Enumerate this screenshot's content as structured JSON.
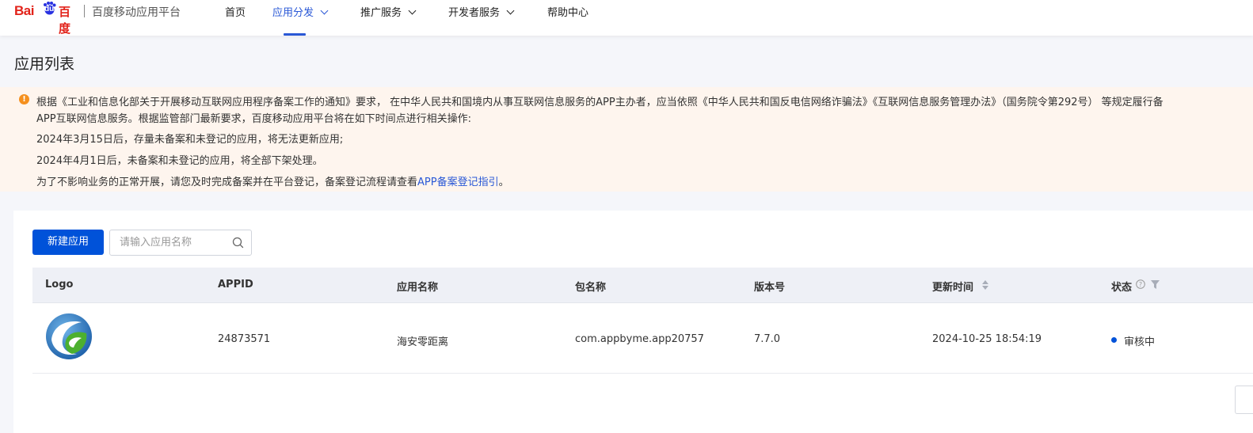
{
  "header": {
    "logo_latin": "Bai",
    "logo_du": "du",
    "logo_cn": "百度",
    "platform_name": "百度移动应用平台",
    "nav": [
      {
        "label": "首页",
        "active": false,
        "dropdown": false
      },
      {
        "label": "应用分发",
        "active": true,
        "dropdown": true
      },
      {
        "label": "推广服务",
        "active": false,
        "dropdown": true
      },
      {
        "label": "开发者服务",
        "active": false,
        "dropdown": true
      },
      {
        "label": "帮助中心",
        "active": false,
        "dropdown": false
      }
    ]
  },
  "page": {
    "title": "应用列表"
  },
  "notice": {
    "icon": "warning-icon",
    "line1": "根据《工业和信息化部关于开展移动互联网应用程序备案工作的通知》要求， 在中华人民共和国境内从事互联网信息服务的APP主办者，应当依照《中华人民共和国反电信网络诈骗法》《互联网信息服务管理办法》（国务院令第292号） 等规定履行备",
    "line2": "APP互联网信息服务。根据监管部门最新要求，百度移动应用平台将在如下时间点进行相关操作:",
    "line3": "2024年3月15日后，存量未备案和未登记的应用，将无法更新应用;",
    "line4": "2024年4月1日后，未备案和未登记的应用，将全部下架处理。",
    "line5_prefix": "为了不影响业务的正常开展，请您及时完成备案并在平台登记，备案登记流程请查看",
    "line5_link": "APP备案登记指引",
    "line5_suffix": "。"
  },
  "toolbar": {
    "new_app_label": "新建应用",
    "search_placeholder": "请输入应用名称",
    "search_value": ""
  },
  "table": {
    "columns": [
      "Logo",
      "APPID",
      "应用名称",
      "包名称",
      "版本号",
      "更新时间",
      "状态"
    ],
    "rows": [
      {
        "logo": "app-logo-icon",
        "appid": "24873571",
        "name": "海安零距离",
        "package": "com.appbyme.app20757",
        "version": "7.7.0",
        "updated": "2024-10-25 18:54:19",
        "status": "审核中"
      }
    ]
  },
  "colors": {
    "primary": "#0052d9",
    "link": "#2a58d6",
    "brand_red": "#e2231a",
    "notice_bg": "#fef5ee",
    "warning": "#f5901e"
  }
}
